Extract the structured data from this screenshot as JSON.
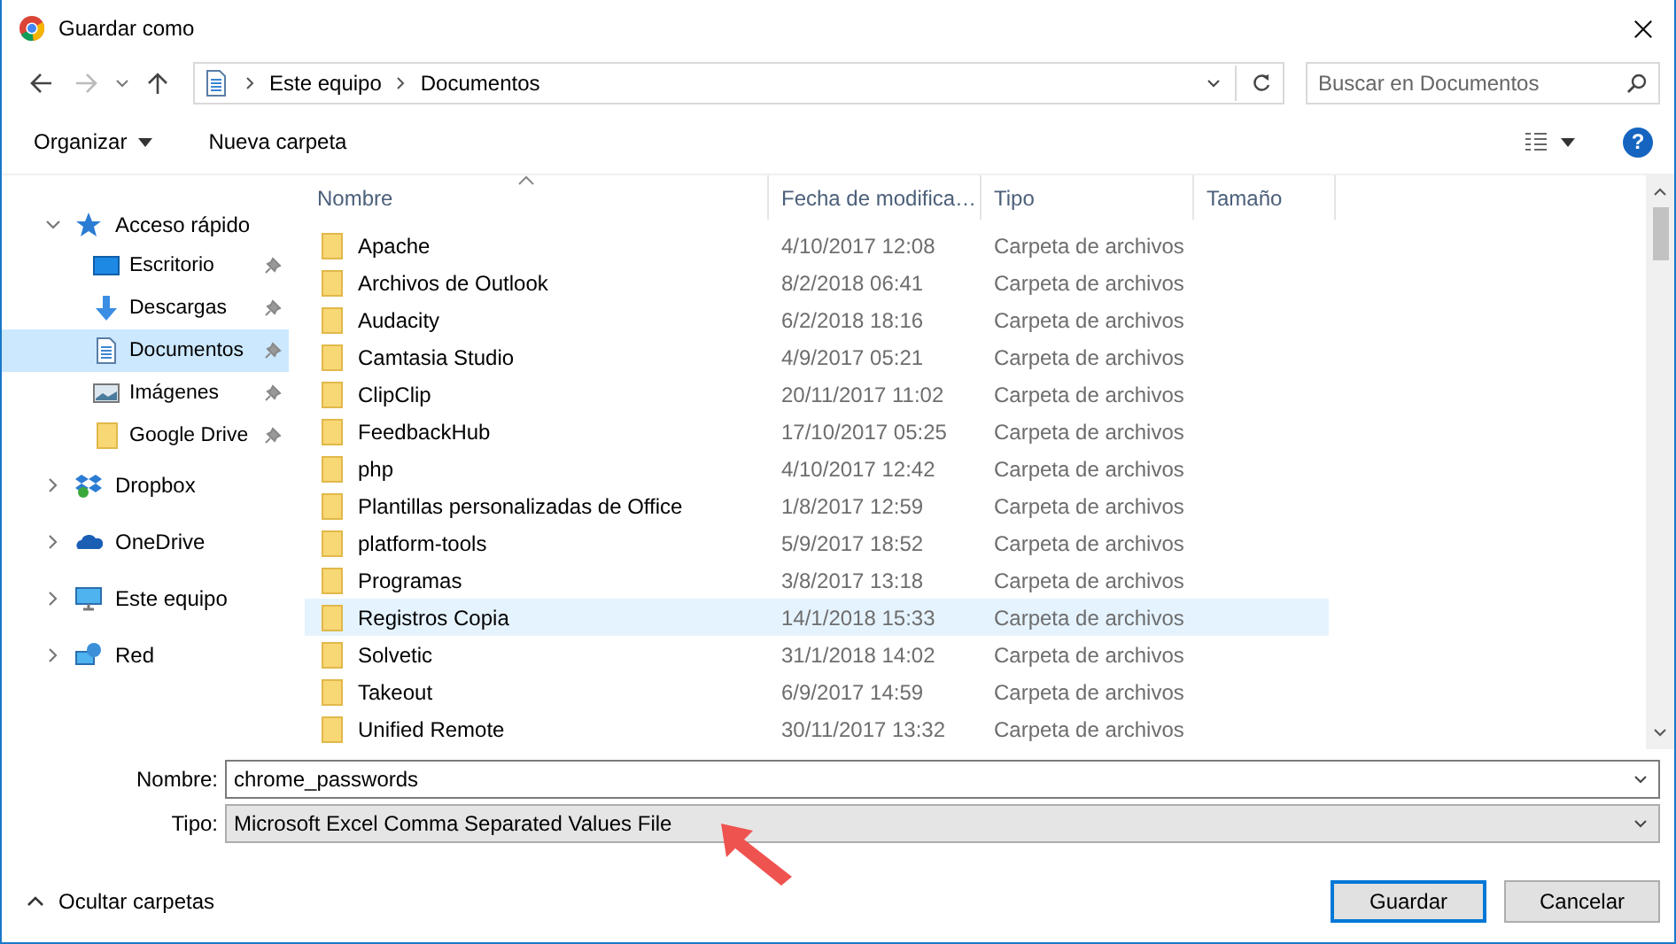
{
  "window": {
    "title": "Guardar como"
  },
  "address": {
    "path": [
      "Este equipo",
      "Documentos"
    ]
  },
  "search": {
    "placeholder": "Buscar en Documentos"
  },
  "toolbar": {
    "organize": "Organizar",
    "new_folder": "Nueva carpeta",
    "help": "?"
  },
  "sidebar": {
    "items": [
      {
        "label": "Acceso rápido",
        "kind": "star",
        "expanded": true,
        "children": [
          {
            "label": "Escritorio",
            "kind": "desktop",
            "pinned": true,
            "selected": false
          },
          {
            "label": "Descargas",
            "kind": "download",
            "pinned": true,
            "selected": false
          },
          {
            "label": "Documentos",
            "kind": "document",
            "pinned": true,
            "selected": true
          },
          {
            "label": "Imágenes",
            "kind": "image",
            "pinned": true,
            "selected": false
          },
          {
            "label": "Google Drive",
            "kind": "folder",
            "pinned": true,
            "selected": false
          }
        ]
      },
      {
        "label": "Dropbox",
        "kind": "dropbox",
        "expanded": false
      },
      {
        "label": "OneDrive",
        "kind": "cloud",
        "expanded": false
      },
      {
        "label": "Este equipo",
        "kind": "computer",
        "expanded": false
      },
      {
        "label": "Red",
        "kind": "network",
        "expanded": false
      }
    ]
  },
  "table": {
    "columns": [
      {
        "label": "Nombre",
        "sorted": true
      },
      {
        "label": "Fecha de modifica…",
        "sorted": false
      },
      {
        "label": "Tipo",
        "sorted": false
      },
      {
        "label": "Tamaño",
        "sorted": false
      }
    ],
    "rows": [
      {
        "name": "Apache",
        "date": "4/10/2017 12:08",
        "type": "Carpeta de archivos",
        "selected": false
      },
      {
        "name": "Archivos de Outlook",
        "date": "8/2/2018 06:41",
        "type": "Carpeta de archivos",
        "selected": false
      },
      {
        "name": "Audacity",
        "date": "6/2/2018 18:16",
        "type": "Carpeta de archivos",
        "selected": false
      },
      {
        "name": "Camtasia Studio",
        "date": "4/9/2017 05:21",
        "type": "Carpeta de archivos",
        "selected": false
      },
      {
        "name": "ClipClip",
        "date": "20/11/2017 11:02",
        "type": "Carpeta de archivos",
        "selected": false
      },
      {
        "name": "FeedbackHub",
        "date": "17/10/2017 05:25",
        "type": "Carpeta de archivos",
        "selected": false
      },
      {
        "name": "php",
        "date": "4/10/2017 12:42",
        "type": "Carpeta de archivos",
        "selected": false
      },
      {
        "name": "Plantillas personalizadas de Office",
        "date": "1/8/2017 12:59",
        "type": "Carpeta de archivos",
        "selected": false
      },
      {
        "name": "platform-tools",
        "date": "5/9/2017 18:52",
        "type": "Carpeta de archivos",
        "selected": false
      },
      {
        "name": "Programas",
        "date": "3/8/2017 13:18",
        "type": "Carpeta de archivos",
        "selected": false
      },
      {
        "name": "Registros Copia",
        "date": "14/1/2018 15:33",
        "type": "Carpeta de archivos",
        "selected": true
      },
      {
        "name": "Solvetic",
        "date": "31/1/2018 14:02",
        "type": "Carpeta de archivos",
        "selected": false
      },
      {
        "name": "Takeout",
        "date": "6/9/2017 14:59",
        "type": "Carpeta de archivos",
        "selected": false
      },
      {
        "name": "Unified Remote",
        "date": "30/11/2017 13:32",
        "type": "Carpeta de archivos",
        "selected": false
      }
    ]
  },
  "form": {
    "name_label": "Nombre:",
    "name_value": "chrome_passwords",
    "type_label": "Tipo:",
    "type_value": "Microsoft Excel Comma Separated Values File"
  },
  "footer": {
    "toggle": "Ocultar carpetas",
    "save": "Guardar",
    "cancel": "Cancelar"
  }
}
